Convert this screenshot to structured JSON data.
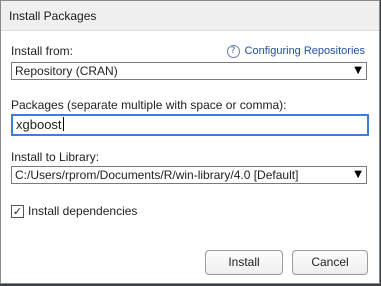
{
  "window": {
    "title": "Install Packages"
  },
  "install_from": {
    "label": "Install from:",
    "selected": "Repository (CRAN)",
    "help_link": "Configuring Repositories"
  },
  "packages": {
    "label": "Packages (separate multiple with space or comma):",
    "value": "xgboost"
  },
  "library": {
    "label": "Install to Library:",
    "selected": "C:/Users/rprom/Documents/R/win-library/4.0 [Default]"
  },
  "dependencies": {
    "label": "Install dependencies",
    "checked": true
  },
  "buttons": {
    "install": "Install",
    "cancel": "Cancel"
  },
  "icons": {
    "help": "?",
    "dropdown": "▼",
    "check": "✓"
  }
}
